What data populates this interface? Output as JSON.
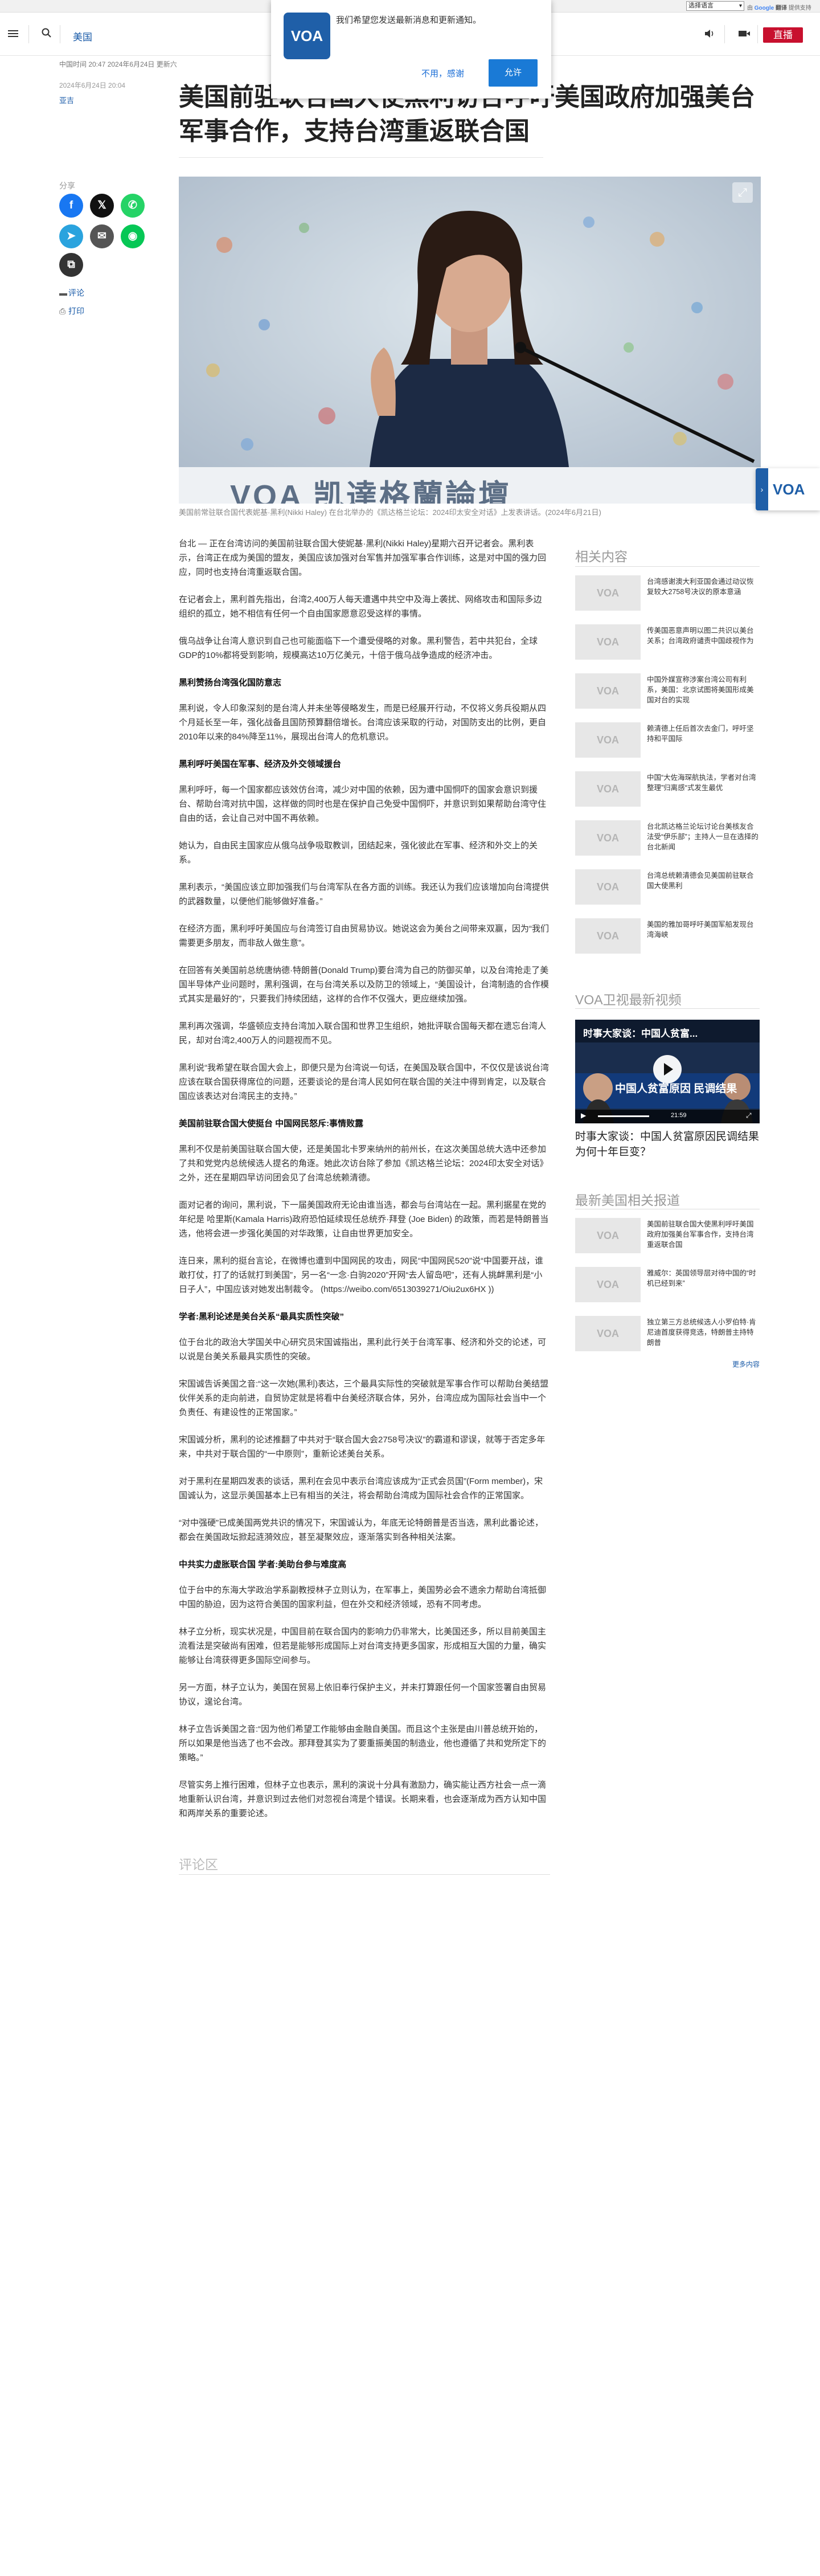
{
  "topbar": {
    "language_select": "选择语言",
    "powered_by": "由",
    "google": "Google",
    "translate": "翻译",
    "provider": "提供支持"
  },
  "header": {
    "section": "美国",
    "live": "直播"
  },
  "notification": {
    "logo": "VOA",
    "message": "我们希望您发送最新消息和更新通知。",
    "decline": "不用，感谢",
    "allow": "允许"
  },
  "article_meta": {
    "timestamp_line": "中国时间 20:47 2024年6月24日 更新六",
    "date": "2024年6月24日 20:04",
    "author": "亚吉",
    "title": "美国前驻联合国大使黑利访台呼吁美国政府加强美台军事合作，支持台湾重返联合国"
  },
  "sidebar": {
    "share_label": "分享",
    "comment": "评论",
    "print": "打印"
  },
  "photo": {
    "banner_text": "VOA 凯達格蘭論壇",
    "caption": "美国前常驻联合国代表妮基·黑利(Nikki Haley) 在台北举办的《凯达格兰论坛：2024印太安全对话》上发表讲话。(2024年6月21日)"
  },
  "article_body": [
    {
      "type": "p",
      "text": "台北 — 正在台湾访问的美国前驻联合国大使妮基·黑利(Nikki Haley)星期六召开记者会。黑利表示，台湾正在成为美国的盟友，美国应该加强对台军售并加强军事合作训练，这是对中国的强力回应，同时也支持台湾重返联合国。"
    },
    {
      "type": "p",
      "text": "在记者会上，黑利首先指出，台湾2,400万人每天遭遇中共空中及海上袭扰、网络攻击和国际多边组织的孤立，她不相信有任何一个自由国家愿意忍受这样的事情。"
    },
    {
      "type": "p",
      "text": "俄乌战争让台湾人意识到自己也可能面临下一个遭受侵略的对象。黑利警告，若中共犯台，全球GDP的10%都将受到影响，规模高达10万亿美元，十倍于俄乌战争造成的经济冲击。"
    },
    {
      "type": "h",
      "text": "黑利赞扬台湾强化国防意志"
    },
    {
      "type": "p",
      "text": "黑利说，令人印象深刻的是台湾人并未坐等侵略发生，而是已经展开行动，不仅将义务兵役期从四个月延长至一年，强化战备且国防预算翻倍增长。台湾应该采取的行动，对国防支出的比例，更自2010年以来的84%降至11%，展现出台湾人的危机意识。"
    },
    {
      "type": "h",
      "text": "黑利呼吁美国在军事、经济及外交领域援台"
    },
    {
      "type": "p",
      "text": "黑利呼吁，每一个国家都应该效仿台湾，减少对中国的依赖，因为遭中国恫吓的国家会意识到援台、帮助台湾对抗中国，这样做的同时也是在保护自己免受中国恫吓，并意识到如果帮助台湾守住自由的话，会让自己对中国不再依赖。"
    },
    {
      "type": "p",
      "text": "她认为，自由民主国家应从俄乌战争吸取教训，团结起来，强化彼此在军事、经济和外交上的关系。"
    },
    {
      "type": "p",
      "text": "黑利表示，“美国应该立即加强我们与台湾军队在各方面的训练。我还认为我们应该增加向台湾提供的武器数量，以便他们能够做好准备。”"
    },
    {
      "type": "p",
      "text": "在经济方面，黑利呼吁美国应与台湾签订自由贸易协议。她说这会为美台之间带来双赢，因为“我们需要更多朋友，而非敌人做生意”。"
    },
    {
      "type": "p",
      "text": "在回答有关美国前总统唐纳德·特朗普(Donald Trump)要台湾为自己的防御买单，以及台湾抢走了美国半导体产业问题时，黑利强调，在与台湾关系以及防卫的领域上，“美国设计，台湾制造的合作模式其实是最好的”，只要我们持续团结，这样的合作不仅强大，更应继续加强。"
    },
    {
      "type": "p",
      "text": "黑利再次强调，华盛顿应支持台湾加入联合国和世界卫生组织，她批评联合国每天都在遗忘台湾人民，却对台湾2,400万人的问题视而不见。"
    },
    {
      "type": "p",
      "text": "黑利说“我希望在联合国大会上，即便只是为台湾说一句话，在美国及联合国中，不仅仅是该说台湾应该在联合国获得席位的问题，还要谈论的是台湾人民如何在联合国的关注中得到肯定，以及联合国应该表达对台湾民主的支持。”"
    },
    {
      "type": "h",
      "text": "美国前驻联合国大使挺台 中国网民怒斥:事情败露"
    },
    {
      "type": "p",
      "text": "黑利不仅是前美国驻联合国大使，还是美国北卡罗来纳州的前州长，在这次美国总统大选中还参加了共和党党内总统候选人提名的角逐。她此次访台除了参加《凯达格兰论坛：2024印太安全对话》之外，还在星期四早访问团会见了台湾总统赖清德。"
    },
    {
      "type": "p",
      "text": "面对记者的询问，黑利说，下一届美国政府无论由谁当选，都会与台湾站在一起。黑利据星在党的年纪是 哈里斯(Kamala Harris)政府恐怕延续现任总统乔·拜登 (Joe Biden) 的政策，而若是特朗普当选，他将会进一步强化美国的对华政策，让自由世界更加安全。"
    },
    {
      "type": "p",
      "text": "连日来，黑利的挺台言论，在微博也遭到中国网民的攻击，网民“中国网民520”说“中国要开战，谁敢打仗，打了的话就打到美国”，另一名“一念·白驹2020”开网“去人留岛吧”，还有人挑衅黑利是“小日子人”，中国应该对她发出制裁令。 (https://weibo.com/6513039271/Oiu2ux6HX ))"
    },
    {
      "type": "h",
      "text": "学者:黑利论述是美台关系“最具实质性突破”"
    },
    {
      "type": "p",
      "text": "位于台北的政治大学国关中心研究员宋国诚指出，黑利此行关于台湾军事、经济和外交的论述，可以说是台美关系最具实质性的突破。"
    },
    {
      "type": "p",
      "text": "宋国诚告诉美国之音:“这一次她(黑利)表达，三个最具实际性的突破就是军事合作可以帮助台美结盟伙伴关系的走向前进，自贸协定就是将看中台美经济联合体，另外，台湾应成为国际社会当中一个负责任、有建设性的正常国家。”"
    },
    {
      "type": "p",
      "text": "宋国诚分析，黑利的论述推翻了中共对于“联合国大会2758号决议”的霸道和谬误，就等于否定多年来，中共对于联合国的“一中原则”，重新论述美台关系。"
    },
    {
      "type": "p",
      "text": "对于黑利在星期四发表的谈话，黑利在会见中表示台湾应该成为“正式会员国”(Form member)，宋国诚认为，这显示美国基本上已有相当的关注，将会帮助台湾成为国际社会合作的正常国家。"
    },
    {
      "type": "p",
      "text": "“对中强硬”已成美国两党共识的情况下，宋国诚认为，年底无论特朗普是否当选，黑利此番论述，都会在美国政坛掀起涟漪效应，甚至凝聚效应，逐渐落实到各种相关法案。"
    },
    {
      "type": "h",
      "text": "中共实力虚胀联合国 学者:美助台参与难度高"
    },
    {
      "type": "p",
      "text": "位于台中的东海大学政治学系副教授林子立则认为，在军事上，美国势必会不遗余力帮助台湾抵御中国的胁迫，因为这符合美国的国家利益，但在外交和经济领域，恐有不同考虑。"
    },
    {
      "type": "p",
      "text": "林子立分析，现实状况是，中国目前在联合国内的影响力仍非常大，比美国还多，所以目前美国主流看法是突破尚有困难，但若是能够形成国际上对台湾支持更多国家，形成相互大国的力量，确实能够让台湾获得更多国际空间参与。"
    },
    {
      "type": "p",
      "text": "另一方面，林子立认为，美国在贸易上依旧奉行保护主义，并未打算跟任何一个国家签署自由贸易协议，遑论台湾。"
    },
    {
      "type": "p",
      "text": "林子立告诉美国之音:“因为他们希望工作能够由金融自美国。而且这个主张是由川普总统开始的，所以如果是他当选了也不会改。那拜登其实为了要重振美国的制造业，他也遵循了共和党所定下的策略。”"
    },
    {
      "type": "p",
      "text": "尽管实务上推行困难，但林子立也表示，黑利的演说十分具有激励力，确实能让西方社会一点一滴地重新认识台湾，并意识到过去他们对忽视台湾是个错误。长期来看，也会逐渐成为西方认知中国和两岸关系的重要论述。"
    }
  ],
  "comments_label": "评论区",
  "right_rail": {
    "related_title": "相关内容",
    "related": [
      "台湾感谢澳大利亚国会通过动议恢复较大2758号决议的原本意涵",
      "传美国恶意声明以图二共识以美台关系；台湾政府谴责中国歧视作为",
      "中国外媒宣称涉案台湾公司有利系，美国：北京试图将美国形成美国对台的实现",
      "赖清德上任后首次去金门，呼吁坚持和平国际",
      "中国“大佐海琛航执法，学者对台湾整理”归离感“式发生最优",
      "台北凯达格兰论坛讨论台美核友合法受“伊乐部”；主持人一旦在选择的台北新闻",
      "台湾总统赖清德会见美国前驻联合国大使黑利",
      "美国的雅加哥呼吁美国军船发现台湾海峡"
    ],
    "video_title": "VOA卫视最新视频",
    "video": {
      "overlay_title": "时事大家谈：中国人贫富...",
      "banner": "中国人贫富原因 民调结果",
      "time": "21:59",
      "caption": "时事大家谈：中国人贫富原因民调结果为何十年巨变？"
    },
    "latest_title": "最新美国相关报道",
    "latest": [
      "美国前驻联合国大使黑利呼吁美国政府加强美台军事合作，支持台湾重返联合国",
      "雅威尔：英国领导层对待中国的“时机已经到来”",
      "独立第三方总统候选人小罗伯特·肯尼迪首度获得竞选，特朗普主持特朗普"
    ],
    "more": "更多内容"
  },
  "colors": {
    "accent_blue": "#1a5ba8",
    "live_red": "#c8102e",
    "voa_blue": "#1f5fa8"
  }
}
